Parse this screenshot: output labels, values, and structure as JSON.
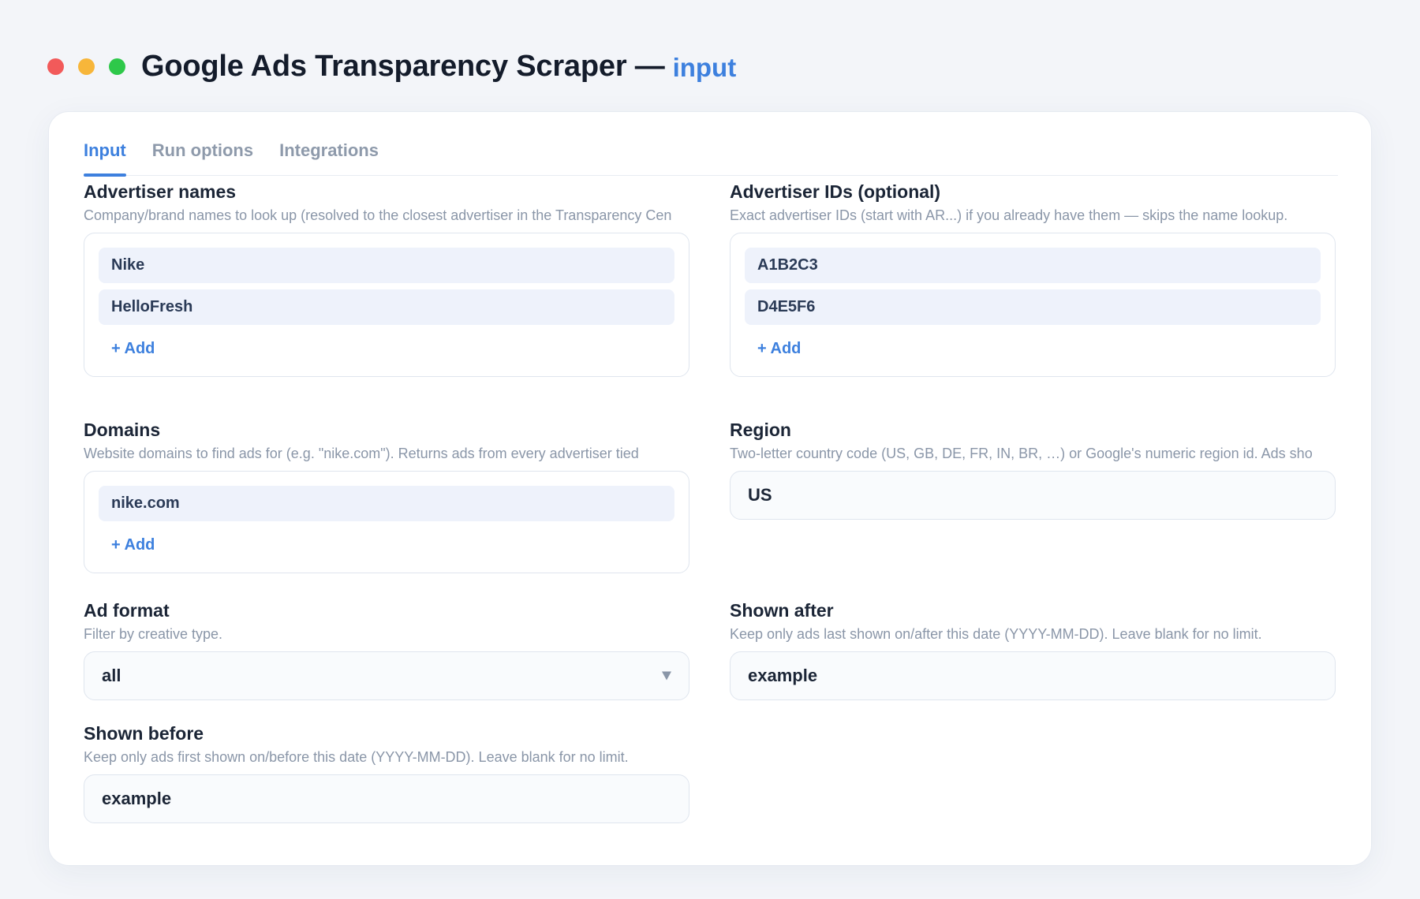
{
  "header": {
    "title": "Google Ads Transparency Scraper —",
    "subtitle": "input",
    "window_controls": [
      "close",
      "minimize",
      "maximize"
    ]
  },
  "tabs": [
    {
      "label": "Input",
      "active": true
    },
    {
      "label": "Run options",
      "active": false
    },
    {
      "label": "Integrations",
      "active": false
    }
  ],
  "fields": {
    "advertiser_names": {
      "label": "Advertiser names",
      "description": "Company/brand names to look up (resolved to the closest advertiser in the Transparency Cen",
      "items": [
        "Nike",
        "HelloFresh"
      ],
      "add_label": "+ Add"
    },
    "advertiser_ids": {
      "label": "Advertiser IDs (optional)",
      "description": "Exact advertiser IDs (start with AR...) if you already have them — skips the name lookup.",
      "items": [
        "A1B2C3",
        "D4E5F6"
      ],
      "add_label": "+ Add"
    },
    "domains": {
      "label": "Domains",
      "description": "Website domains to find ads for (e.g. \"nike.com\"). Returns ads from every advertiser tied",
      "items": [
        "nike.com"
      ],
      "add_label": "+ Add"
    },
    "region": {
      "label": "Region",
      "description": "Two-letter country code (US, GB, DE, FR, IN, BR, …) or Google's numeric region id. Ads sho",
      "value": "US"
    },
    "ad_format": {
      "label": "Ad format",
      "description": "Filter by creative type.",
      "value": "all"
    },
    "shown_after": {
      "label": "Shown after",
      "description": "Keep only ads last shown on/after this date (YYYY-MM-DD). Leave blank for no limit.",
      "value": "example"
    },
    "shown_before": {
      "label": "Shown before",
      "description": "Keep only ads first shown on/before this date (YYYY-MM-DD). Leave blank for no limit.",
      "value": "example"
    }
  },
  "colors": {
    "accent": "#3d80de",
    "close": "#f25a5a",
    "minimize": "#f7b63a",
    "maximize": "#2ec84a"
  }
}
